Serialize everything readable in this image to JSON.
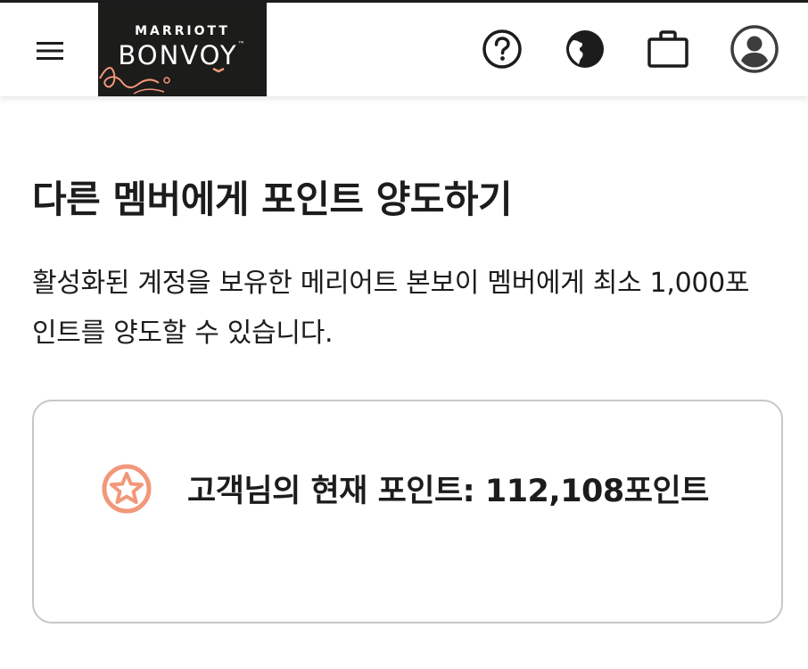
{
  "header": {
    "brand_top": "MARRIOTT",
    "brand_main": "BONVOY",
    "brand_mark": "™",
    "icons": [
      "menu-icon",
      "help-icon",
      "globe-icon",
      "briefcase-icon",
      "account-icon"
    ]
  },
  "main": {
    "title": "다른 멤버에게 포인트 양도하기",
    "description": "활성화된 계정을 보유한 메리어트 본보이 멤버에게 최소 1,000포인트를 양도할 수 있습니다.",
    "points_card": {
      "text": "고객님의 현재 포인트: 112,108포인트",
      "icon": "star-icon"
    }
  },
  "colors": {
    "accent": "#f3977a",
    "text": "#1c1c1c",
    "logo_bg": "#1c1c1a",
    "card_border": "#c7c7c7"
  }
}
